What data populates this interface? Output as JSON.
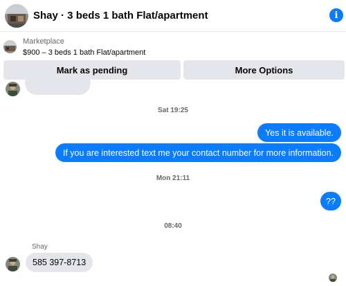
{
  "header": {
    "title": "Shay · 3 beds 1 bath Flat/apartment",
    "info_icon": "info-icon"
  },
  "listing": {
    "label": "Marketplace",
    "price_title": "$900 – 3 beds 1 bath Flat/apartment"
  },
  "actions": {
    "mark_pending": "Mark as pending",
    "more_options": "More Options"
  },
  "thread": {
    "timestamps": [
      "Sat 19:25",
      "Mon 21:11",
      "08:40"
    ],
    "outgoing": [
      "Yes it is available.",
      "If you are interested text me your contact number for more information.",
      "??"
    ],
    "sender_name": "Shay",
    "incoming": [
      "585 397-8713"
    ]
  },
  "colors": {
    "accent": "#0a7cff",
    "bubble_incoming": "#e4e6eb",
    "button_bg": "#e4e6eb",
    "muted_text": "#65676b"
  }
}
